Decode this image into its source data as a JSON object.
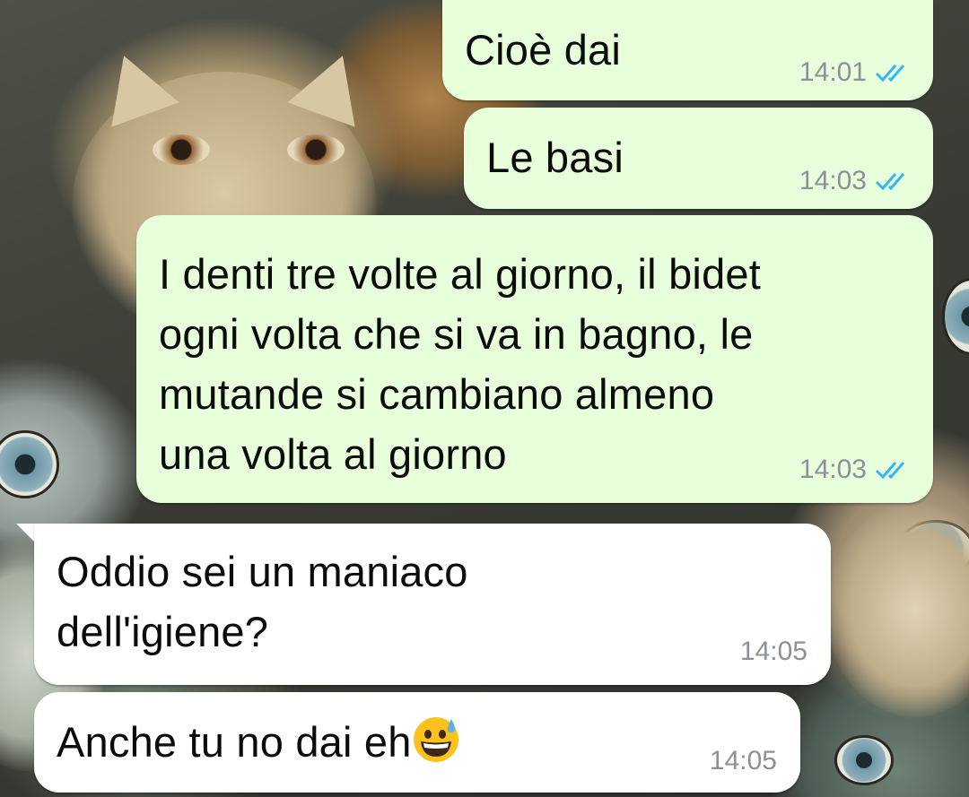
{
  "chat": {
    "messages": [
      {
        "direction": "outgoing",
        "text": "Cioè dai",
        "time": "14:01",
        "status": "read"
      },
      {
        "direction": "outgoing",
        "text": "Le basi",
        "time": "14:03",
        "status": "read"
      },
      {
        "direction": "outgoing",
        "lines": [
          "I denti tre volte al giorno, il bidet",
          "ogni volta che si va in bagno, le",
          "mutande si cambiano almeno",
          "una volta al giorno"
        ],
        "time": "14:03",
        "status": "read"
      },
      {
        "direction": "incoming",
        "lines": [
          "Oddio sei un maniaco",
          "dell'igiene?"
        ],
        "time": "14:05"
      },
      {
        "direction": "incoming",
        "text": "Anche tu no dai eh",
        "emoji": "grinning-face-with-sweat",
        "time": "14:05"
      }
    ]
  },
  "colors": {
    "outgoing_bubble": "#e7ffdb",
    "incoming_bubble": "#ffffff",
    "read_ticks": "#34b7f1",
    "timestamp": "#8a9199"
  }
}
